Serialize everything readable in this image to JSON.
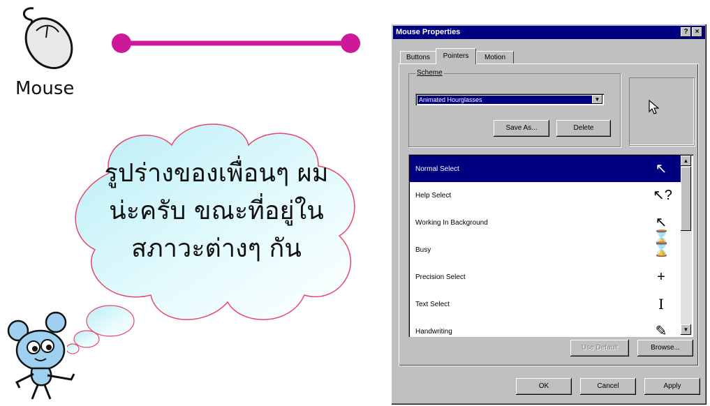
{
  "left": {
    "mouse_caption": "Mouse",
    "cloud_lines": [
      "รูปร่างของเพื่อนๆ ผม",
      "น่ะครับ ขณะที่อยู่ใน",
      "สภาวะต่างๆ กัน"
    ]
  },
  "dialog": {
    "title": "Mouse Properties",
    "help_btn": "?",
    "close_btn": "×",
    "tabs": [
      "Buttons",
      "Pointers",
      "Motion"
    ],
    "active_tab": "Pointers",
    "scheme": {
      "label": "Scheme",
      "value": "Animated Hourglasses",
      "save_as": "Save As...",
      "delete": "Delete"
    },
    "cursor_rows": [
      {
        "label": "Normal Select",
        "icon": "arrow-cursor-icon",
        "glyph": "↖"
      },
      {
        "label": "Help Select",
        "icon": "help-cursor-icon",
        "glyph": "↖?"
      },
      {
        "label": "Working In Background",
        "icon": "working-cursor-icon",
        "glyph": "↖⌛"
      },
      {
        "label": "Busy",
        "icon": "hourglass-icon",
        "glyph": "⌛"
      },
      {
        "label": "Precision Select",
        "icon": "crosshair-icon",
        "glyph": "+"
      },
      {
        "label": "Text Select",
        "icon": "ibeam-icon",
        "glyph": "I"
      },
      {
        "label": "Handwriting",
        "icon": "pen-cursor-icon",
        "glyph": "✎"
      }
    ],
    "use_default": "Use Default",
    "browse": "Browse...",
    "ok": "OK",
    "cancel": "Cancel",
    "apply": "Apply"
  },
  "colors": {
    "titlebar": "#000080",
    "selection": "#000080",
    "line": "#cc1899",
    "cloud_fill": "#cdf4f8",
    "cloud_stroke": "#e8456a"
  }
}
